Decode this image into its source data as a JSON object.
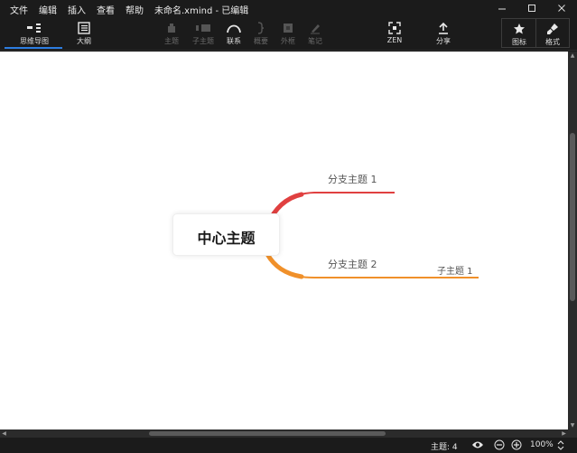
{
  "menu": {
    "items": [
      "文件",
      "编辑",
      "插入",
      "查看",
      "帮助"
    ],
    "title": "未命名.xmind - 已编辑"
  },
  "window_controls": {
    "minimize": "—",
    "maximize": "☐",
    "close": "✕"
  },
  "toolbar": {
    "view_tabs": [
      {
        "label": "思维导图",
        "icon": "mindmap-icon",
        "active": true
      },
      {
        "label": "大纲",
        "icon": "outline-icon",
        "active": false
      }
    ],
    "insert_buttons": [
      {
        "label": "主题",
        "icon": "topic-icon",
        "enabled": false
      },
      {
        "label": "子主题",
        "icon": "subtopic-icon",
        "enabled": false
      },
      {
        "label": "联系",
        "icon": "relationship-icon",
        "enabled": true
      },
      {
        "label": "概要",
        "icon": "summary-icon",
        "enabled": false
      },
      {
        "label": "外框",
        "icon": "boundary-icon",
        "enabled": false
      },
      {
        "label": "笔记",
        "icon": "note-icon",
        "enabled": false
      }
    ],
    "zen": {
      "label": "ZEN",
      "icon": "fullscreen-icon"
    },
    "share": {
      "label": "分享",
      "icon": "share-icon"
    },
    "panels": [
      {
        "label": "图标",
        "icon": "star-icon"
      },
      {
        "label": "格式",
        "icon": "brush-icon"
      }
    ]
  },
  "mindmap": {
    "central_topic": "中心主题",
    "branches": [
      {
        "label": "分支主题 1",
        "color": "#e04040",
        "children": []
      },
      {
        "label": "分支主题 2",
        "color": "#f0902a",
        "children": [
          "子主题 1"
        ]
      }
    ]
  },
  "status": {
    "topic_count_label": "主题: 4",
    "zoom": "100%"
  },
  "colors": {
    "accent": "#2d7de0",
    "chrome_bg": "#1b1b1b",
    "canvas_bg": "#ffffff",
    "branch1": "#e04040",
    "branch2": "#f0902a"
  }
}
